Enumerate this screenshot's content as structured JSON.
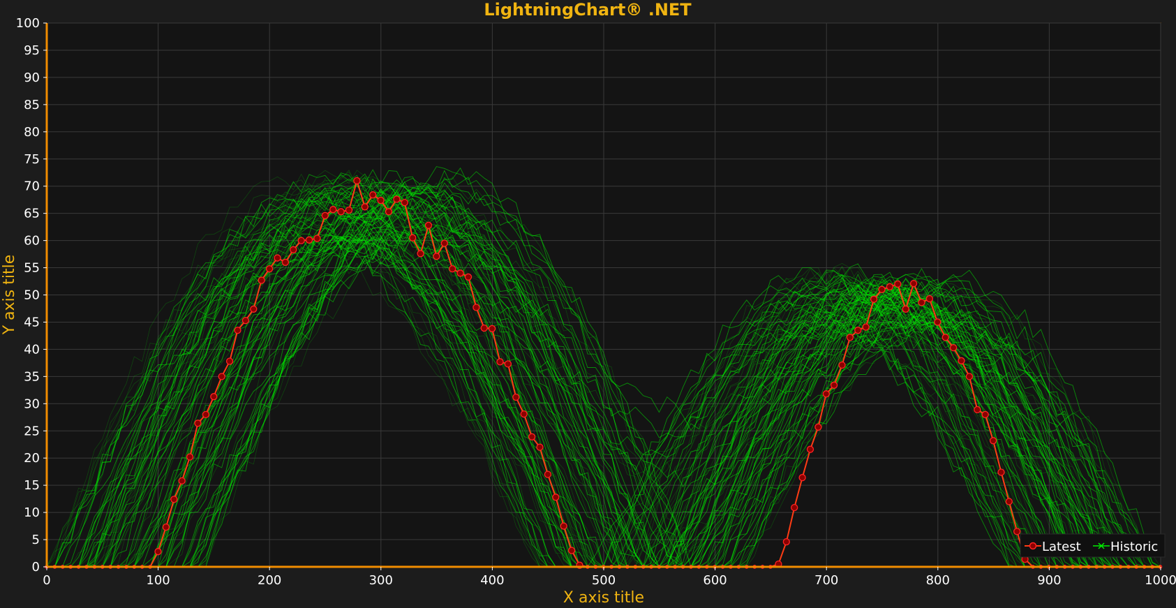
{
  "colors": {
    "background": "#1c1c1c",
    "plot_background": "#141414",
    "title": "#f0b411",
    "axis": "#f08c00",
    "grid": "#3a3a3a",
    "latest_line": "#ff3c14",
    "latest_marker": "#8b0000",
    "historic": "#00ee00"
  },
  "chart_data": {
    "type": "line",
    "title": "LightningChart® .NET",
    "xlabel": "X axis title",
    "ylabel": "Y axis title",
    "xlim": [
      0,
      1000
    ],
    "ylim": [
      0,
      100
    ],
    "x_ticks": [
      0,
      100,
      200,
      300,
      400,
      500,
      600,
      700,
      800,
      900,
      1000
    ],
    "y_ticks": [
      0,
      5,
      10,
      15,
      20,
      25,
      30,
      35,
      40,
      45,
      50,
      55,
      60,
      65,
      70,
      75,
      80,
      85,
      90,
      95,
      100
    ],
    "grid": true,
    "legend_position": "bottom-right",
    "legend": [
      {
        "name": "Latest",
        "marker": "circle"
      },
      {
        "name": "Historic",
        "marker": "x"
      }
    ],
    "series": [
      {
        "name": "Latest",
        "x_step": 7.14,
        "values": [
          0,
          0,
          0,
          0,
          0,
          0,
          0,
          0,
          0,
          0,
          0,
          0,
          0,
          0,
          2.8,
          7.3,
          12.4,
          15.8,
          20.2,
          26.4,
          28.0,
          31.3,
          35.0,
          37.8,
          43.5,
          45.3,
          47.4,
          52.7,
          54.8,
          56.8,
          56.0,
          58.3,
          60.0,
          60.1,
          60.4,
          64.6,
          65.7,
          65.3,
          65.6,
          71.0,
          66.2,
          68.4,
          67.4,
          65.3,
          67.6,
          67.0,
          60.5,
          57.6,
          62.8,
          57.1,
          59.5,
          54.8,
          54.0,
          53.3,
          47.7,
          43.9,
          43.8,
          37.7,
          37.3,
          31.2,
          28.1,
          23.9,
          22.0,
          17.0,
          12.8,
          7.5,
          3.0,
          0.3,
          0,
          0,
          0,
          0,
          0,
          0,
          0,
          0,
          0,
          0,
          0,
          0,
          0,
          0,
          0,
          0,
          0,
          0,
          0,
          0,
          0,
          0,
          0,
          0,
          0.5,
          4.6,
          10.9,
          16.4,
          21.6,
          25.7,
          31.8,
          33.4,
          37.1,
          42.2,
          43.5,
          44.1,
          49.2,
          51.0,
          51.5,
          52.0,
          47.4,
          52.1,
          48.6,
          49.3,
          45.0,
          42.2,
          40.3,
          37.9,
          35.0,
          28.9,
          28.0,
          23.2,
          17.4,
          12.0,
          6.5,
          1.4,
          0,
          0,
          0,
          0,
          0,
          0,
          0,
          0,
          0,
          0,
          0,
          0,
          0,
          0,
          0,
          0,
          0,
          0,
          0
        ]
      },
      {
        "name": "Historic",
        "description_free": true,
        "envelope_lobes": [
          {
            "x_start": 70,
            "x_peak_start": 250,
            "x_peak_end": 340,
            "x_end": 510,
            "peak": 72
          },
          {
            "x_start": 560,
            "x_peak_start": 660,
            "x_peak_end": 830,
            "x_end": 930,
            "peak": 54
          }
        ]
      }
    ]
  }
}
